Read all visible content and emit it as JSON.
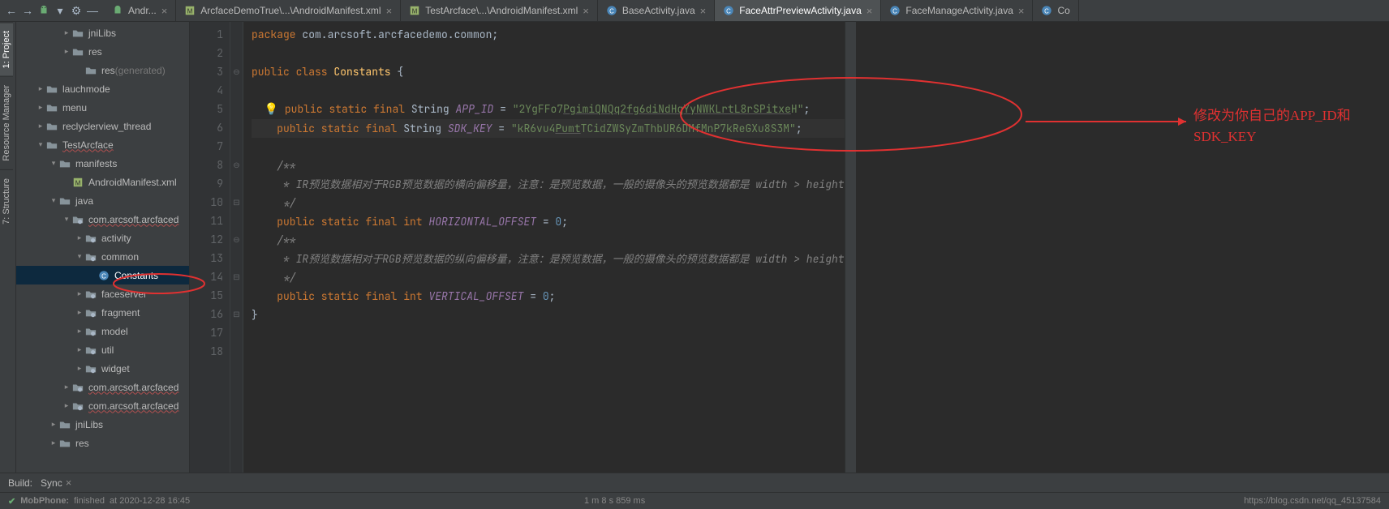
{
  "toolbar": {
    "tabs": [
      {
        "icon": "android",
        "label": "Andr...",
        "close": true
      },
      {
        "icon": "manifest",
        "label": "ArcfaceDemoTrue\\...\\AndroidManifest.xml",
        "close": true
      },
      {
        "icon": "manifest",
        "label": "TestArcface\\...\\AndroidManifest.xml",
        "close": true
      },
      {
        "icon": "java",
        "label": "BaseActivity.java",
        "close": true
      },
      {
        "icon": "java",
        "label": "FaceAttrPreviewActivity.java",
        "close": true,
        "selected": true
      },
      {
        "icon": "java",
        "label": "FaceManageActivity.java",
        "close": true
      },
      {
        "icon": "java",
        "label": "Co",
        "close": false
      }
    ]
  },
  "leftbar": {
    "items": [
      {
        "label": "1: Project",
        "selected": true
      },
      {
        "label": "Resource Manager"
      },
      {
        "label": "7: Structure"
      }
    ]
  },
  "tree": {
    "items": [
      {
        "d": 3,
        "a": "r",
        "i": "folder",
        "label": "jniLibs"
      },
      {
        "d": 3,
        "a": "r",
        "i": "folder",
        "label": "res"
      },
      {
        "d": 4,
        "a": "",
        "i": "folder",
        "label": "res",
        "extra": "(generated)"
      },
      {
        "d": 1,
        "a": "r",
        "i": "folder",
        "label": "lauchmode"
      },
      {
        "d": 1,
        "a": "r",
        "i": "folder",
        "label": "menu"
      },
      {
        "d": 1,
        "a": "r",
        "i": "folder",
        "label": "reclyclerview_thread"
      },
      {
        "d": 1,
        "a": "d",
        "i": "folder",
        "label": "TestArcface",
        "wave": true
      },
      {
        "d": 2,
        "a": "d",
        "i": "folder",
        "label": "manifests"
      },
      {
        "d": 3,
        "a": "",
        "i": "manifest",
        "label": "AndroidManifest.xml"
      },
      {
        "d": 2,
        "a": "d",
        "i": "folder",
        "label": "java"
      },
      {
        "d": 3,
        "a": "d",
        "i": "pkg",
        "label": "com.arcsoft.arcfaced",
        "wave": true
      },
      {
        "d": 4,
        "a": "r",
        "i": "pkg",
        "label": "activity"
      },
      {
        "d": 4,
        "a": "d",
        "i": "pkg",
        "label": "common"
      },
      {
        "d": 5,
        "a": "",
        "i": "class",
        "label": "Constants",
        "sel": true
      },
      {
        "d": 4,
        "a": "r",
        "i": "pkg",
        "label": "faceserver"
      },
      {
        "d": 4,
        "a": "r",
        "i": "pkg",
        "label": "fragment"
      },
      {
        "d": 4,
        "a": "r",
        "i": "pkg",
        "label": "model"
      },
      {
        "d": 4,
        "a": "r",
        "i": "pkg",
        "label": "util"
      },
      {
        "d": 4,
        "a": "r",
        "i": "pkg",
        "label": "widget"
      },
      {
        "d": 3,
        "a": "r",
        "i": "pkg",
        "label": "com.arcsoft.arcfaced",
        "wave": true
      },
      {
        "d": 3,
        "a": "r",
        "i": "pkg",
        "label": "com.arcsoft.arcfaced",
        "wave": true
      },
      {
        "d": 2,
        "a": "r",
        "i": "folder",
        "label": "jniLibs"
      },
      {
        "d": 2,
        "a": "r",
        "i": "folder",
        "label": "res"
      }
    ]
  },
  "code": {
    "lines": [
      {
        "n": 1,
        "html": "<span class='kw'>package </span>com.arcsoft.arcfacedemo.common;"
      },
      {
        "n": 2,
        "html": ""
      },
      {
        "n": 3,
        "html": "<span class='kw'>public class </span><span class='typ'>Constants</span> {"
      },
      {
        "n": 4,
        "html": ""
      },
      {
        "n": 5,
        "html": "  <span class='bulb'>💡</span> <span class='kw'>public static final </span>String <span class='fld'>APP_ID</span> = <span class='str'>\"2YgFFo7<span class='ul'>PgimiQNQq2fg6diNdHqYyNWKLrtL8rSPitxe</span>H\"</span>;"
      },
      {
        "n": 6,
        "html": "    <span class='kw'>public static final </span>String <span class='fld'>SDK_KEY</span> = <span class='str'>\"kR6vu4<span class='ul'>Pumt</span>TCidZWSyZmThbUR6DMfMnP7kReGXu8S3M\"</span>;",
        "hl": true
      },
      {
        "n": 7,
        "html": ""
      },
      {
        "n": 8,
        "html": "    <span class='cmt'>/**</span>"
      },
      {
        "n": 9,
        "html": "<span class='cmt'>     * IR预览数据相对于RGB预览数据的横向偏移量，注意：是预览数据，一般的摄像头的预览数据都是 width &gt; height</span>"
      },
      {
        "n": 10,
        "html": "<span class='cmt'>     */</span>"
      },
      {
        "n": 11,
        "html": "    <span class='kw'>public static final int </span><span class='fld'>HORIZONTAL_OFFSET</span> = <span style='color:#6897bb'>0</span>;"
      },
      {
        "n": 12,
        "html": "    <span class='cmt'>/**</span>"
      },
      {
        "n": 13,
        "html": "<span class='cmt'>     * IR预览数据相对于RGB预览数据的纵向偏移量，注意：是预览数据，一般的摄像头的预览数据都是 width &gt; height</span>"
      },
      {
        "n": 14,
        "html": "<span class='cmt'>     */</span>"
      },
      {
        "n": 15,
        "html": "    <span class='kw'>public static final int </span><span class='fld'>VERTICAL_OFFSET</span> = <span style='color:#6897bb'>0</span>;"
      },
      {
        "n": 16,
        "html": "}"
      },
      {
        "n": 17,
        "html": ""
      },
      {
        "n": 18,
        "html": ""
      }
    ]
  },
  "annotation": {
    "text1": "修改为你自己的APP_ID和",
    "text2": "SDK_KEY"
  },
  "build": {
    "label": "Build:",
    "sync": "Sync"
  },
  "status": {
    "icon": "✔",
    "device": "MobPhone:",
    "state": "finished",
    "at": "at 2020-12-28 16:45",
    "time": "1 m 8 s 859 ms",
    "watermark": "https://blog.csdn.net/qq_45137584"
  }
}
